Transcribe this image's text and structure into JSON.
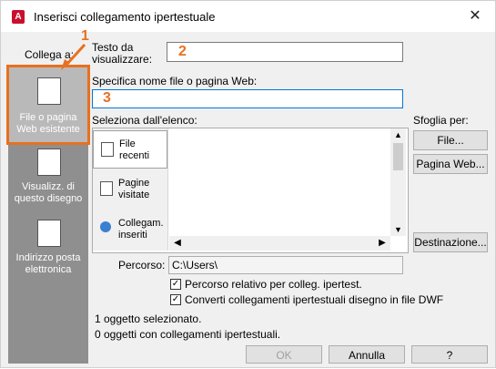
{
  "window": {
    "title": "Inserisci collegamento ipertestuale",
    "app_icon_letter": "A"
  },
  "link_to": {
    "label": "Collega a:"
  },
  "text_to_display": {
    "label": "Testo da visualizzare:",
    "value": ""
  },
  "filename": {
    "label": "Specifica nome file o pagina Web:",
    "value": ""
  },
  "select_from_list": {
    "label": "Seleziona dall'elenco:"
  },
  "browse": {
    "label": "Sfoglia per:",
    "file_button": "File...",
    "web_button": "Pagina Web...",
    "target_button": "Destinazione..."
  },
  "sidebar": {
    "items": [
      {
        "label": "File o pagina Web esistente",
        "active": true
      },
      {
        "label": "Visualizz. di questo disegno",
        "active": false
      },
      {
        "label": "Indirizzo posta elettronica",
        "active": false
      }
    ]
  },
  "list_categories": [
    {
      "label": "File recenti"
    },
    {
      "label": "Pagine visitate"
    },
    {
      "label": "Collegam. inseriti"
    }
  ],
  "path": {
    "label": "Percorso:",
    "value": "C:\\Users\\"
  },
  "options": [
    {
      "label": "Percorso relativo per colleg. ipertest.",
      "checked": true
    },
    {
      "label": "Converti collegamenti ipertestuali disegno in file DWF",
      "checked": true
    }
  ],
  "status": {
    "line1": "1 oggetto selezionato.",
    "line2": "0 oggetti con collegamenti ipertestuali."
  },
  "buttons": {
    "ok": "OK",
    "cancel": "Annulla",
    "help": "?"
  },
  "callouts": {
    "n1": "1",
    "n2": "2",
    "n3": "3"
  },
  "colors": {
    "accent": "#e8701f",
    "sidebar": "#8f8f8f",
    "active_sidebar": "#b9b9b9",
    "focus": "#0078d7"
  }
}
